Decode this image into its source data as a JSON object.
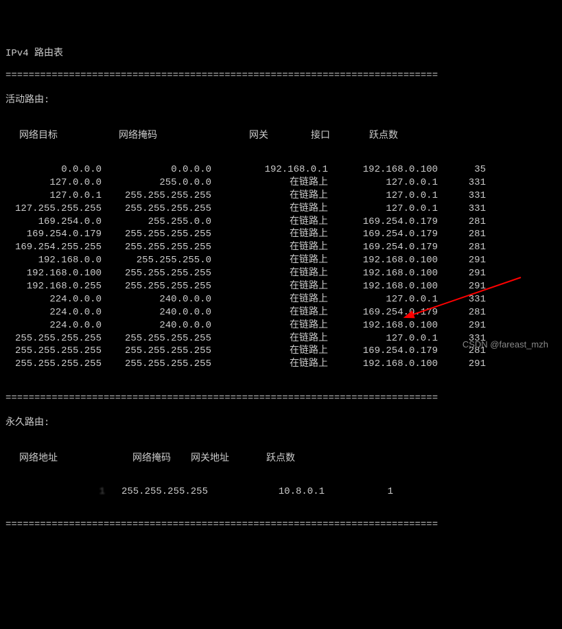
{
  "title": "IPv4 路由表",
  "divider": "===========================================================================",
  "active": {
    "label": "活动路由:",
    "headers": {
      "dest": "网络目标",
      "mask": "网络掩码",
      "gateway": "网关",
      "interface": "接口",
      "metric": "跃点数"
    },
    "rows": [
      {
        "dest": "0.0.0.0",
        "mask": "0.0.0.0",
        "gateway": "192.168.0.1",
        "interface": "192.168.0.100",
        "metric": "35"
      },
      {
        "dest": "127.0.0.0",
        "mask": "255.0.0.0",
        "gateway": "在链路上",
        "interface": "127.0.0.1",
        "metric": "331"
      },
      {
        "dest": "127.0.0.1",
        "mask": "255.255.255.255",
        "gateway": "在链路上",
        "interface": "127.0.0.1",
        "metric": "331"
      },
      {
        "dest": "127.255.255.255",
        "mask": "255.255.255.255",
        "gateway": "在链路上",
        "interface": "127.0.0.1",
        "metric": "331"
      },
      {
        "dest": "169.254.0.0",
        "mask": "255.255.0.0",
        "gateway": "在链路上",
        "interface": "169.254.0.179",
        "metric": "281"
      },
      {
        "dest": "169.254.0.179",
        "mask": "255.255.255.255",
        "gateway": "在链路上",
        "interface": "169.254.0.179",
        "metric": "281"
      },
      {
        "dest": "169.254.255.255",
        "mask": "255.255.255.255",
        "gateway": "在链路上",
        "interface": "169.254.0.179",
        "metric": "281"
      },
      {
        "dest": "192.168.0.0",
        "mask": "255.255.255.0",
        "gateway": "在链路上",
        "interface": "192.168.0.100",
        "metric": "291"
      },
      {
        "dest": "192.168.0.100",
        "mask": "255.255.255.255",
        "gateway": "在链路上",
        "interface": "192.168.0.100",
        "metric": "291"
      },
      {
        "dest": "192.168.0.255",
        "mask": "255.255.255.255",
        "gateway": "在链路上",
        "interface": "192.168.0.100",
        "metric": "291"
      },
      {
        "dest": "224.0.0.0",
        "mask": "240.0.0.0",
        "gateway": "在链路上",
        "interface": "127.0.0.1",
        "metric": "331"
      },
      {
        "dest": "224.0.0.0",
        "mask": "240.0.0.0",
        "gateway": "在链路上",
        "interface": "169.254.0.179",
        "metric": "281"
      },
      {
        "dest": "224.0.0.0",
        "mask": "240.0.0.0",
        "gateway": "在链路上",
        "interface": "192.168.0.100",
        "metric": "291"
      },
      {
        "dest": "255.255.255.255",
        "mask": "255.255.255.255",
        "gateway": "在链路上",
        "interface": "127.0.0.1",
        "metric": "331"
      },
      {
        "dest": "255.255.255.255",
        "mask": "255.255.255.255",
        "gateway": "在链路上",
        "interface": "169.254.0.179",
        "metric": "281"
      },
      {
        "dest": "255.255.255.255",
        "mask": "255.255.255.255",
        "gateway": "在链路上",
        "interface": "192.168.0.100",
        "metric": "291"
      }
    ]
  },
  "permanent": {
    "label": "永久路由:",
    "headers": {
      "addr": "网络地址",
      "mask": "网络掩码",
      "gateway": "网关地址",
      "metric": "跃点数"
    },
    "rows": [
      {
        "addr": "1",
        "mask": "255.255.255.255",
        "gateway": "10.8.0.1",
        "metric": "1"
      }
    ]
  },
  "watermark": "CSDN @fareast_mzh"
}
